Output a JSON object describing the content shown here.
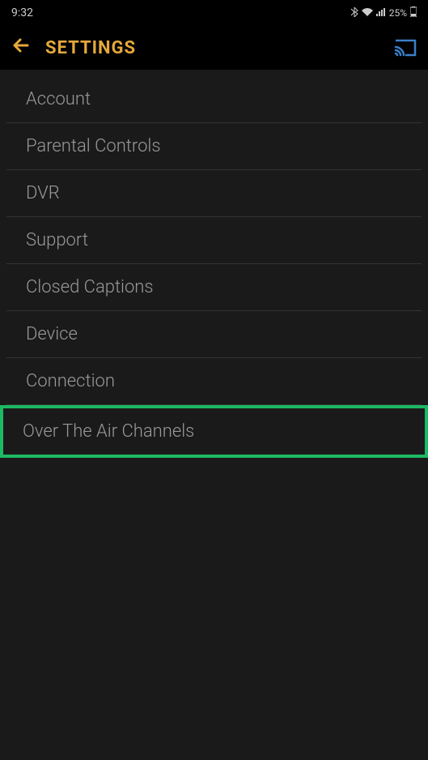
{
  "status_bar": {
    "time": "9:32",
    "battery_percent": "25%",
    "bluetooth_icon": "bluetooth",
    "wifi_icon": "wifi",
    "signal_icon": "signal",
    "battery_icon": "battery"
  },
  "header": {
    "title": "SETTINGS",
    "back_icon": "back-arrow",
    "cast_icon": "cast"
  },
  "settings": {
    "items": [
      {
        "label": "Account",
        "highlighted": false
      },
      {
        "label": "Parental Controls",
        "highlighted": false
      },
      {
        "label": "DVR",
        "highlighted": false
      },
      {
        "label": "Support",
        "highlighted": false
      },
      {
        "label": "Closed Captions",
        "highlighted": false
      },
      {
        "label": "Device",
        "highlighted": false
      },
      {
        "label": "Connection",
        "highlighted": false
      },
      {
        "label": "Over The Air Channels",
        "highlighted": true
      }
    ]
  },
  "colors": {
    "accent": "#e5a83c",
    "highlight": "#1db864",
    "background": "#1a1a1a",
    "text": "#999"
  }
}
